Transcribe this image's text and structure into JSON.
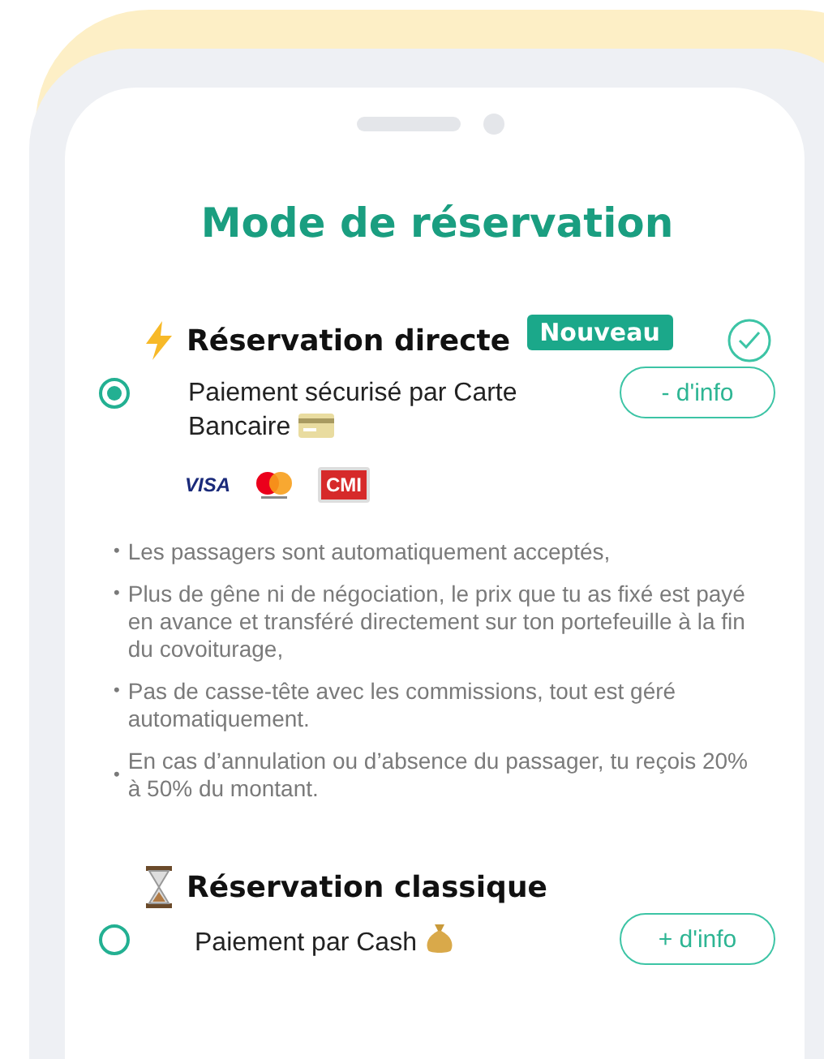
{
  "title": "Mode de réservation",
  "sections": [
    {
      "kind": "direct",
      "heading": "Réservation directe",
      "badge": "Nouveau",
      "selected": true,
      "payment": "Paiement sécurisé par Carte Bancaire",
      "info_button": "- d'info",
      "expanded": true,
      "logos": [
        "VISA",
        "CMI"
      ],
      "bullets": [
        {
          "marker": "•",
          "text": "Les passagers sont automatiquement acceptés,"
        },
        {
          "marker": "•",
          "text": "Plus de gêne ni de négociation, le prix que tu as fixé est payé en avance et transféré directement sur ton portefeuille à la fin du covoiturage,"
        },
        {
          "marker": "•",
          "text": "Pas de casse-tête avec les commissions, tout est géré automatiquement."
        },
        {
          "marker": "•",
          "text": "En cas d’annulation ou d’absence du passager, tu reçois 20% à 50% du montant."
        }
      ]
    },
    {
      "kind": "classic",
      "heading": "Réservation classique",
      "selected": false,
      "payment": "Paiement par Cash",
      "info_button": "+ d'info",
      "expanded": false
    }
  ]
}
